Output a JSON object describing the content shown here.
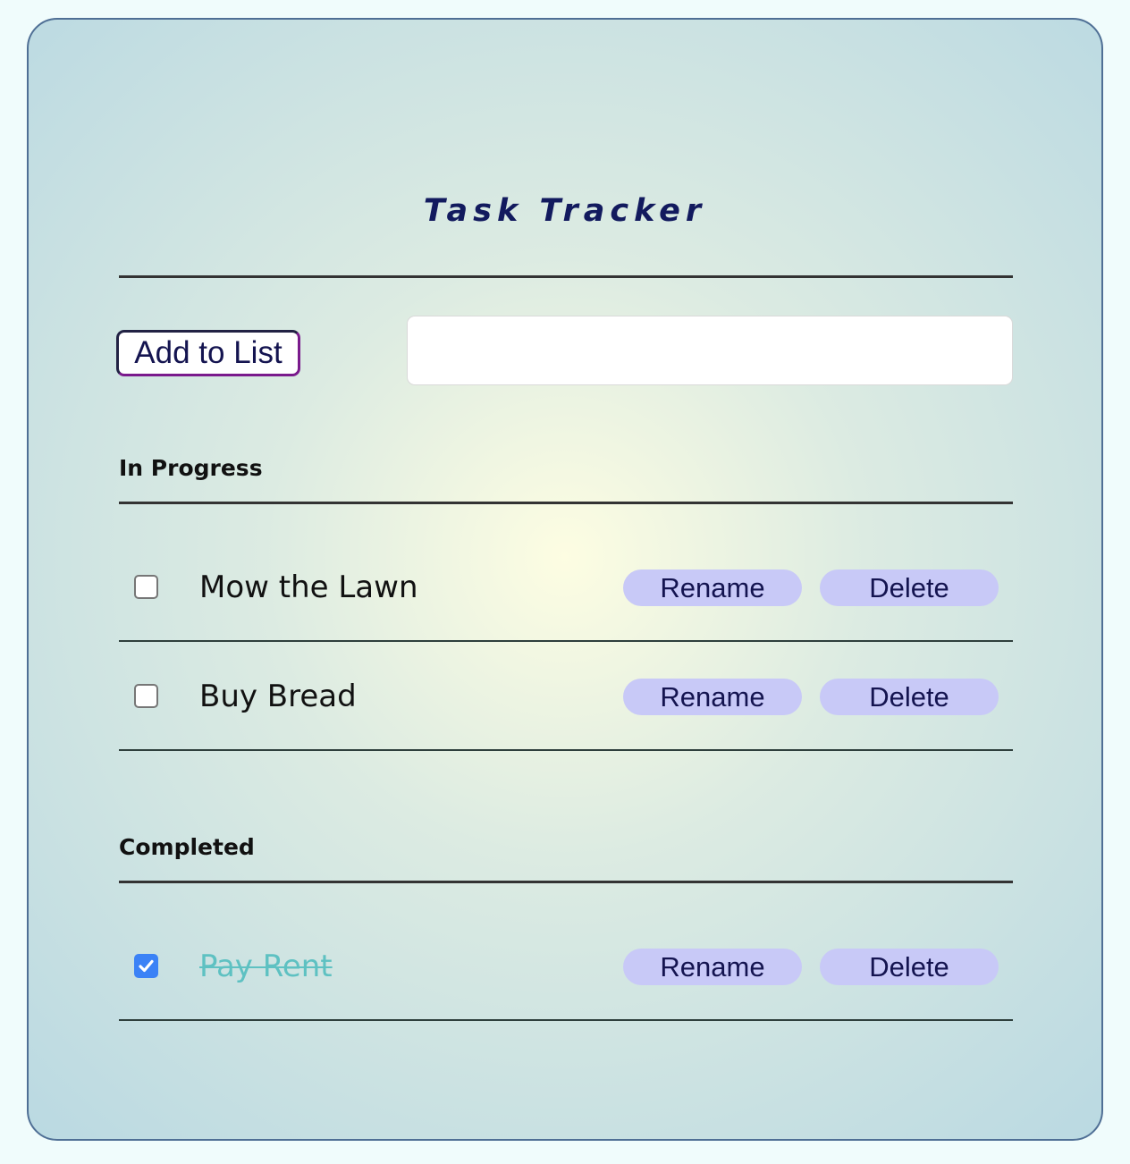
{
  "app": {
    "title": "Task Tracker"
  },
  "add_form": {
    "button_label": "Add to List",
    "input_value": "",
    "input_placeholder": ""
  },
  "sections": {
    "in_progress": {
      "heading": "In Progress",
      "tasks": [
        {
          "label": "Mow the Lawn",
          "checked": false,
          "rename_label": "Rename",
          "delete_label": "Delete"
        },
        {
          "label": "Buy Bread",
          "checked": false,
          "rename_label": "Rename",
          "delete_label": "Delete"
        }
      ]
    },
    "completed": {
      "heading": "Completed",
      "tasks": [
        {
          "label": "Pay Rent",
          "checked": true,
          "rename_label": "Rename",
          "delete_label": "Delete"
        }
      ]
    }
  },
  "colors": {
    "title": "#121a5e",
    "pill_background": "#c8c9f7",
    "completed_text": "#5ec1c2",
    "checkbox_checked": "#3b82f6",
    "card_border": "#4f6f95"
  },
  "icons": {
    "checkmark": "check-icon"
  }
}
